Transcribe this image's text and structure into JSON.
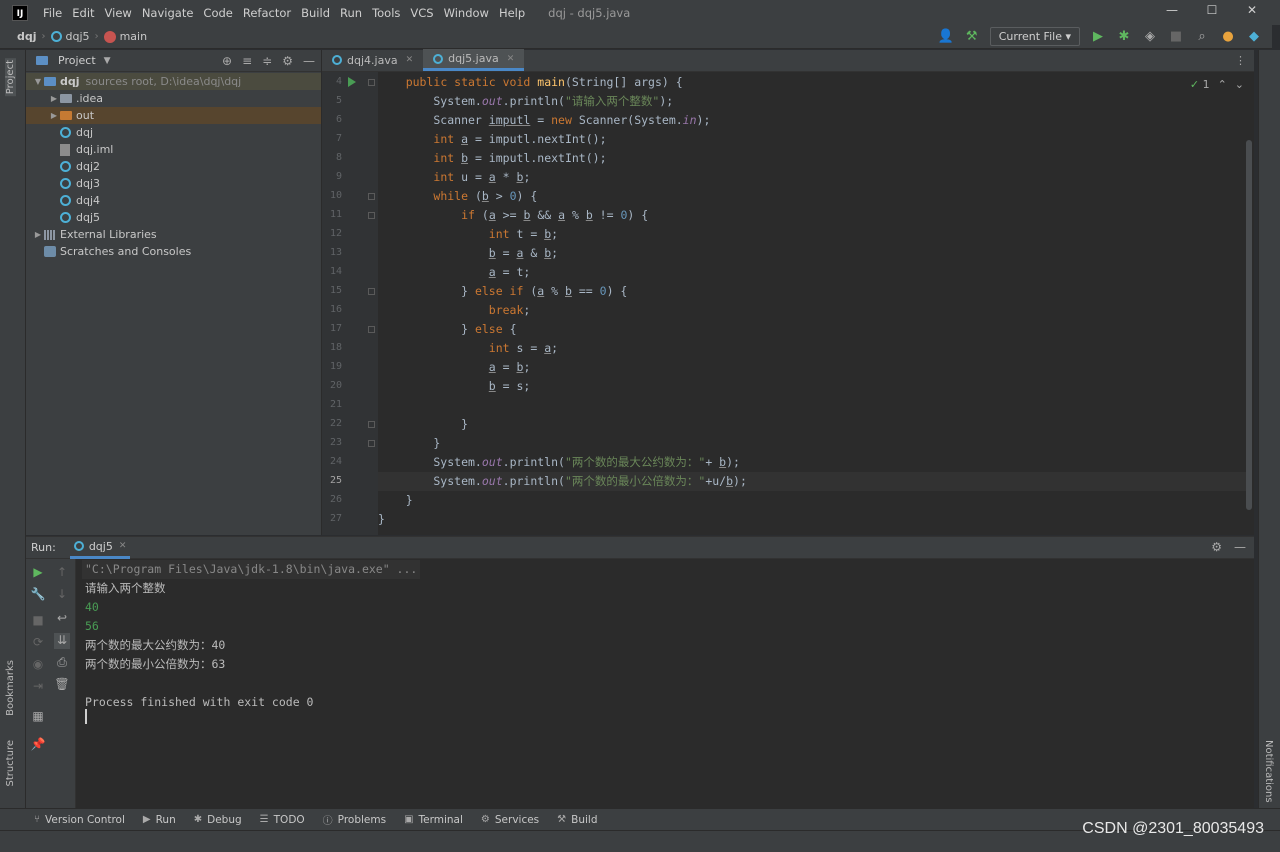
{
  "menu": {
    "logo": "IJ",
    "items": [
      "File",
      "Edit",
      "View",
      "Navigate",
      "Code",
      "Refactor",
      "Build",
      "Run",
      "Tools",
      "VCS",
      "Window",
      "Help"
    ],
    "window_title": "dqj - dqj5.java"
  },
  "navbar": {
    "project": "dqj",
    "module": "dqj5",
    "branch": "main",
    "run_config": "Current File"
  },
  "project_panel": {
    "title": "Project",
    "stripe_label": "Project",
    "tree": [
      {
        "label": "dqj",
        "extra": "sources root,  D:\\idea\\dqj\\dqj",
        "depth": 0,
        "kind": "folder-blue",
        "arrow": "open"
      },
      {
        "label": ".idea",
        "depth": 1,
        "kind": "folder",
        "arrow": "closed"
      },
      {
        "label": "out",
        "depth": 1,
        "kind": "folder-orange",
        "arrow": "closed"
      },
      {
        "label": "dqj",
        "depth": 1,
        "kind": "java"
      },
      {
        "label": "dqj.iml",
        "depth": 1,
        "kind": "iml"
      },
      {
        "label": "dqj2",
        "depth": 1,
        "kind": "java"
      },
      {
        "label": "dqj3",
        "depth": 1,
        "kind": "java"
      },
      {
        "label": "dqj4",
        "depth": 1,
        "kind": "java"
      },
      {
        "label": "dqj5",
        "depth": 1,
        "kind": "java"
      },
      {
        "label": "External Libraries",
        "depth": 0,
        "kind": "libs",
        "arrow": "closed"
      },
      {
        "label": "Scratches and Consoles",
        "depth": 0,
        "kind": "scratch"
      }
    ]
  },
  "editor": {
    "tabs": [
      {
        "label": "dqj4.java",
        "active": false
      },
      {
        "label": "dqj5.java",
        "active": true
      }
    ],
    "inspection_count": "1",
    "lines": [
      {
        "n": "4",
        "html": "    <span class=\"kw\">public static void </span><span class=\"fn\">main</span>(String[] args) {"
      },
      {
        "n": "5",
        "html": "        System.<span class=\"it\">out</span>.println(<span class=\"str\">\"请输入两个整数\"</span>);"
      },
      {
        "n": "6",
        "html": "        Scanner <span class=\"var\">imputl</span> = <span class=\"kw\">new </span>Scanner(System.<span class=\"it\">in</span>);"
      },
      {
        "n": "7",
        "html": "        <span class=\"kw\">int </span><span class=\"var\">a</span> = imputl.nextInt();"
      },
      {
        "n": "8",
        "html": "        <span class=\"kw\">int </span><span class=\"var\">b</span> = imputl.nextInt();"
      },
      {
        "n": "9",
        "html": "        <span class=\"kw\">int </span>u = <span class=\"var\">a</span> * <span class=\"var\">b</span>;"
      },
      {
        "n": "10",
        "html": "        <span class=\"kw\">while </span>(<span class=\"var\">b</span> > <span class=\"num\">0</span>) {"
      },
      {
        "n": "11",
        "html": "            <span class=\"kw\">if </span>(<span class=\"var\">a</span> >= <span class=\"var\">b</span> && <span class=\"var\">a</span> % <span class=\"var\">b</span> != <span class=\"num\">0</span>) {"
      },
      {
        "n": "12",
        "html": "                <span class=\"kw\">int </span>t = <span class=\"var\">b</span>;"
      },
      {
        "n": "13",
        "html": "                <span class=\"var\">b</span> = <span class=\"var\">a</span> & <span class=\"var\">b</span>;"
      },
      {
        "n": "14",
        "html": "                <span class=\"var\">a</span> = t;"
      },
      {
        "n": "15",
        "html": "            } <span class=\"kw\">else if </span>(<span class=\"var\">a</span> % <span class=\"var\">b</span> == <span class=\"num\">0</span>) {"
      },
      {
        "n": "16",
        "html": "                <span class=\"kw\">break</span>;"
      },
      {
        "n": "17",
        "html": "            } <span class=\"kw\">else </span>{"
      },
      {
        "n": "18",
        "html": "                <span class=\"kw\">int </span>s = <span class=\"var\">a</span>;"
      },
      {
        "n": "19",
        "html": "                <span class=\"var\">a</span> = <span class=\"var\">b</span>;"
      },
      {
        "n": "20",
        "html": "                <span class=\"var\">b</span> = s;"
      },
      {
        "n": "21",
        "html": ""
      },
      {
        "n": "22",
        "html": "            }"
      },
      {
        "n": "23",
        "html": "        }"
      },
      {
        "n": "24",
        "html": "        System.<span class=\"it\">out</span>.println(<span class=\"str\">\"两个数的最大公约数为：\"</span>+ <span class=\"var\">b</span>);"
      },
      {
        "n": "25",
        "html": "        System.<span class=\"it\">out</span>.println(<span class=\"str\">\"两个数的最小公倍数为：\"</span>+u/<span class=\"var\">b</span>);",
        "current": true
      },
      {
        "n": "26",
        "html": "    }"
      },
      {
        "n": "27",
        "html": "}"
      }
    ]
  },
  "run_panel": {
    "label": "Run:",
    "tab": "dqj5",
    "console": [
      {
        "text": "\"C:\\Program Files\\Java\\jdk-1.8\\bin\\java.exe\" ...",
        "kind": "cmd"
      },
      {
        "text": "请输入两个整数",
        "kind": "out"
      },
      {
        "text": "40",
        "kind": "input"
      },
      {
        "text": "56",
        "kind": "input"
      },
      {
        "text": "两个数的最大公约数为：40",
        "kind": "out"
      },
      {
        "text": "两个数的最小公倍数为：63",
        "kind": "out"
      },
      {
        "text": "",
        "kind": "out"
      },
      {
        "text": "Process finished with exit code 0",
        "kind": "out"
      }
    ]
  },
  "left_stripe": {
    "bookmarks": "Bookmarks",
    "structure": "Structure"
  },
  "right_stripe": {
    "notifications": "Notifications"
  },
  "bottom_tools": [
    {
      "label": "Version Control",
      "icon": "branch-icon"
    },
    {
      "label": "Run",
      "icon": "run-icon"
    },
    {
      "label": "Debug",
      "icon": "bug-icon"
    },
    {
      "label": "TODO",
      "icon": "list-icon"
    },
    {
      "label": "Problems",
      "icon": "info-icon"
    },
    {
      "label": "Terminal",
      "icon": "terminal-icon"
    },
    {
      "label": "Services",
      "icon": "services-icon"
    },
    {
      "label": "Build",
      "icon": "hammer-icon"
    }
  ],
  "watermark": "CSDN @2301_80035493"
}
